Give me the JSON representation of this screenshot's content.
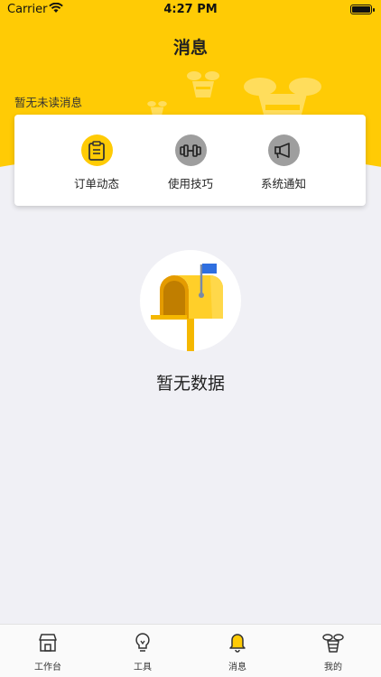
{
  "status_bar": {
    "carrier": "Carrier",
    "time": "4:27 PM"
  },
  "nav": {
    "title": "消息"
  },
  "notice": {
    "unread_text": "暂无未读消息"
  },
  "categories": [
    {
      "label": "订单动态",
      "icon": "clipboard-icon",
      "color": "#ffcb05"
    },
    {
      "label": "使用技巧",
      "icon": "dumbbell-icon",
      "color": "#9e9e9e"
    },
    {
      "label": "系统通知",
      "icon": "megaphone-icon",
      "color": "#9e9e9e"
    }
  ],
  "empty_state": {
    "text": "暂无数据",
    "icon": "mailbox-icon"
  },
  "tabbar": {
    "tabs": [
      {
        "label": "工作台",
        "icon": "store-icon"
      },
      {
        "label": "工具",
        "icon": "lightbulb-icon"
      },
      {
        "label": "消息",
        "icon": "bell-icon",
        "active": true
      },
      {
        "label": "我的",
        "icon": "bee-icon"
      }
    ]
  },
  "colors": {
    "brand": "#ffcb05",
    "background": "#f0f0f5",
    "inactive_icon": "#9e9e9e"
  }
}
